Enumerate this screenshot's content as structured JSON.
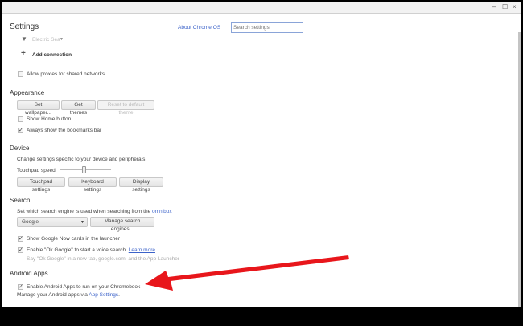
{
  "window": {
    "minimize": "–",
    "maximize": "☐",
    "close": "×"
  },
  "header": {
    "title": "Settings",
    "about": "About Chrome OS",
    "search_placeholder": "Search settings"
  },
  "network": {
    "name": "Electric Sea",
    "add_connection": "Add connection",
    "allow_proxies": "Allow proxies for shared networks"
  },
  "appearance": {
    "title": "Appearance",
    "set_wallpaper": "Set wallpaper...",
    "get_themes": "Get themes",
    "reset_theme": "Reset to default theme",
    "show_home": "Show Home button",
    "show_bookmarks": "Always show the bookmarks bar"
  },
  "device": {
    "title": "Device",
    "description": "Change settings specific to your device and peripherals.",
    "touchpad_speed": "Touchpad speed:",
    "touchpad_speed_value": 0.5,
    "touchpad_settings": "Touchpad settings",
    "keyboard_settings": "Keyboard settings",
    "display_settings": "Display settings"
  },
  "search": {
    "title": "Search",
    "description": "Set which search engine is used when searching from the ",
    "omnibox": "omnibox",
    "engine": "Google",
    "manage": "Manage search engines...",
    "google_now": "Show Google Now cards in the launcher",
    "ok_google": "Enable \"Ok Google\" to start a voice search. ",
    "learn_more": "Learn more",
    "ok_google_hint": "Say \"Ok Google\" in a new tab, google.com, and the App Launcher"
  },
  "android": {
    "title": "Android Apps",
    "enable": "Enable Android Apps to run on your Chromebook",
    "manage": "Manage your Android apps via ",
    "app_settings": "App Settings",
    "period": "."
  },
  "colors": {
    "link": "#3b62c9",
    "arrow": "#e8161b"
  }
}
